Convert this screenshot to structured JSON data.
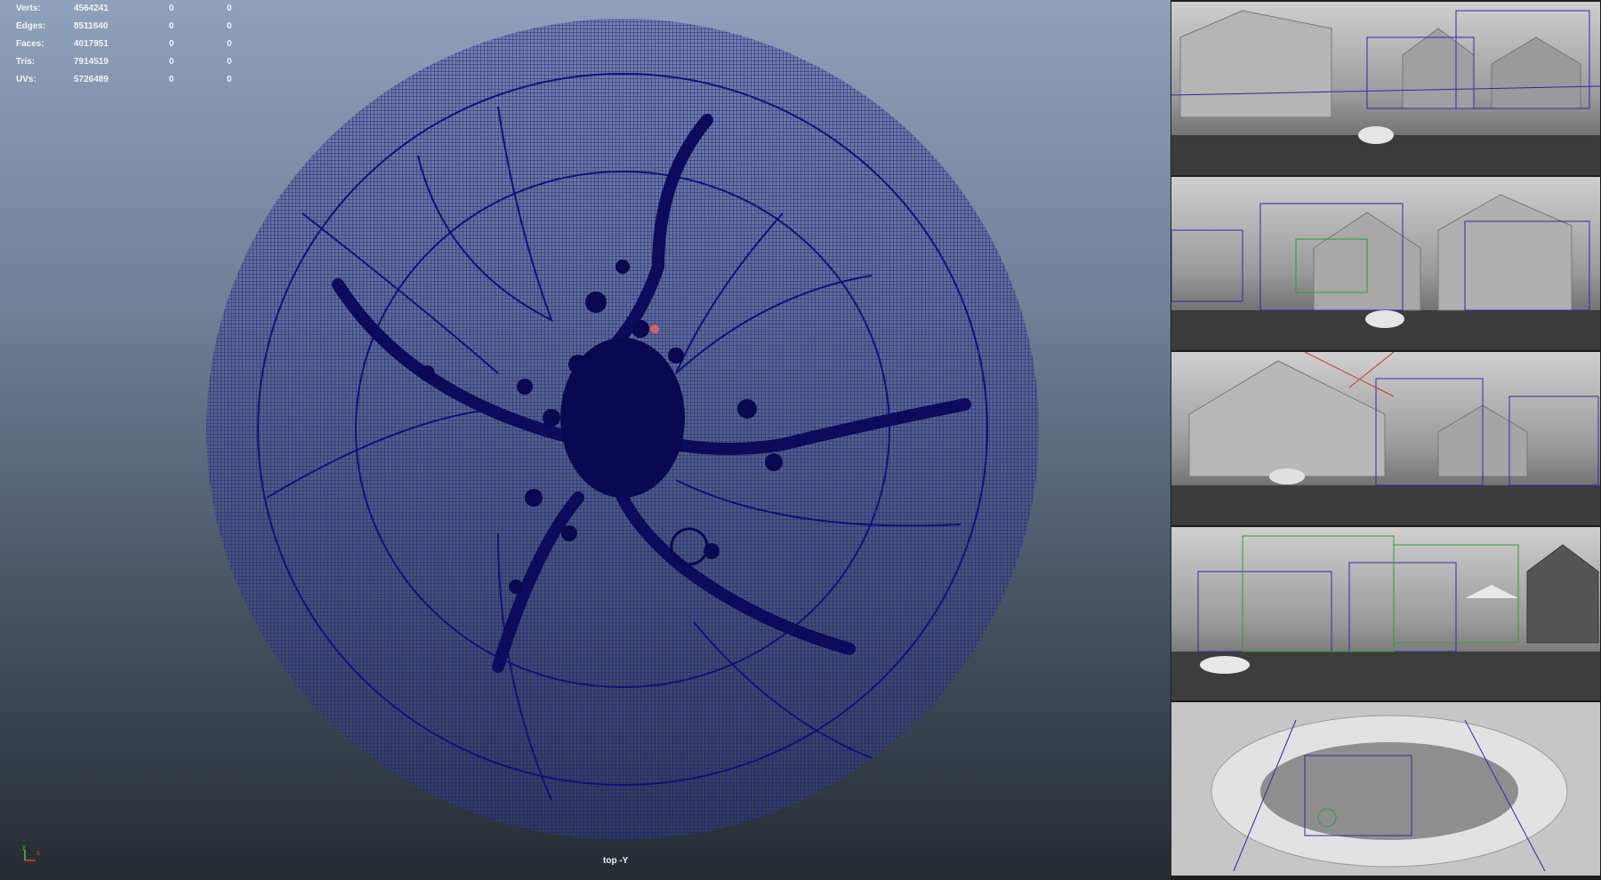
{
  "stats": [
    {
      "label": "Verts:",
      "total": "4564241",
      "selected": "0",
      "extra": "0"
    },
    {
      "label": "Edges:",
      "total": "8511640",
      "selected": "0",
      "extra": "0"
    },
    {
      "label": "Faces:",
      "total": "4017951",
      "selected": "0",
      "extra": "0"
    },
    {
      "label": "Tris:",
      "total": "7914519",
      "selected": "0",
      "extra": "0"
    },
    {
      "label": "UVs:",
      "total": "5726489",
      "selected": "0",
      "extra": "0"
    }
  ],
  "viewport": {
    "camera_label": "top -Y",
    "wire_color": "#17168a",
    "background_top": "#8ea1ba",
    "background_bottom": "#262b32"
  },
  "axis": {
    "y": "y",
    "x": "x"
  },
  "panels": [
    {
      "name": "render-panel-1"
    },
    {
      "name": "render-panel-2"
    },
    {
      "name": "render-panel-3"
    },
    {
      "name": "render-panel-4"
    },
    {
      "name": "render-panel-5"
    }
  ]
}
